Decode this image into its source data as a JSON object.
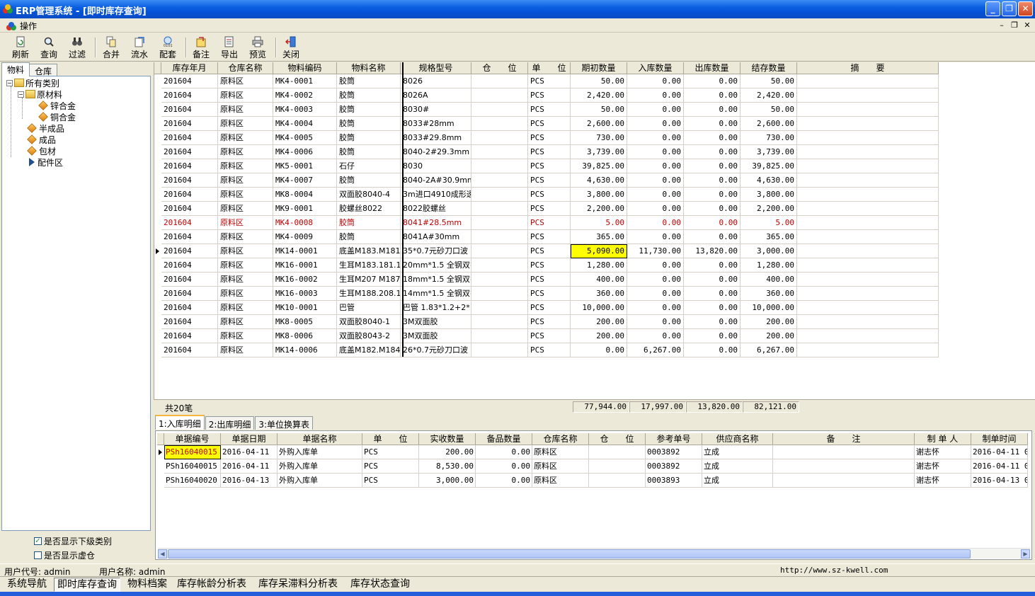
{
  "window": {
    "title": "ERP管理系统 - [即时库存查询]",
    "minimize": "_",
    "maximize": "❐",
    "close": "✕"
  },
  "menu": {
    "label": "操作"
  },
  "toolbar": {
    "refresh": "刷新",
    "query": "查询",
    "filter": "过滤",
    "merge": "合并",
    "flow": "流水",
    "match": "配套",
    "note": "备注",
    "export": "导出",
    "preview": "预览",
    "close": "关闭"
  },
  "left": {
    "tab_material": "物料",
    "tab_warehouse": "仓库",
    "tree": {
      "root": "所有类别",
      "raw": "原材料",
      "zinc": "锌合金",
      "copper": "铜合金",
      "semi": "半成品",
      "finished": "成品",
      "pack": "包材",
      "parts": "配件区"
    },
    "chk_sub": "是否显示下级类别",
    "chk_virtual": "是否显示虚仓"
  },
  "grid": {
    "headers": [
      "库存年月",
      "仓库名称",
      "物料编码",
      "物料名称",
      "规格型号",
      "仓　　位",
      "单　　位",
      "期初数量",
      "入库数量",
      "出库数量",
      "结存数量",
      "摘　　要"
    ],
    "rows": [
      [
        "201604",
        "原料区",
        "MK4-0001",
        "胶筒",
        "8026",
        "",
        "PCS",
        "50.00",
        "0.00",
        "0.00",
        "50.00",
        ""
      ],
      [
        "201604",
        "原料区",
        "MK4-0002",
        "胶筒",
        "8026A",
        "",
        "PCS",
        "2,420.00",
        "0.00",
        "0.00",
        "2,420.00",
        ""
      ],
      [
        "201604",
        "原料区",
        "MK4-0003",
        "胶筒",
        "8030#",
        "",
        "PCS",
        "50.00",
        "0.00",
        "0.00",
        "50.00",
        ""
      ],
      [
        "201604",
        "原料区",
        "MK4-0004",
        "胶筒",
        "8033#28mm",
        "",
        "PCS",
        "2,600.00",
        "0.00",
        "0.00",
        "2,600.00",
        ""
      ],
      [
        "201604",
        "原料区",
        "MK4-0005",
        "胶筒",
        "8033#29.8mm",
        "",
        "PCS",
        "730.00",
        "0.00",
        "0.00",
        "730.00",
        ""
      ],
      [
        "201604",
        "原料区",
        "MK4-0006",
        "胶筒",
        "8040-2#29.3mm",
        "",
        "PCS",
        "3,739.00",
        "0.00",
        "0.00",
        "3,739.00",
        ""
      ],
      [
        "201604",
        "原料区",
        "MK5-0001",
        "石仔",
        "8030",
        "",
        "PCS",
        "39,825.00",
        "0.00",
        "0.00",
        "39,825.00",
        ""
      ],
      [
        "201604",
        "原料区",
        "MK4-0007",
        "胶筒",
        "8040-2A#30.9mm",
        "",
        "PCS",
        "4,630.00",
        "0.00",
        "0.00",
        "4,630.00",
        ""
      ],
      [
        "201604",
        "原料区",
        "MK8-0004",
        "双面胶8040-4",
        "3m进口4910成形透",
        "",
        "PCS",
        "3,800.00",
        "0.00",
        "0.00",
        "3,800.00",
        ""
      ],
      [
        "201604",
        "原料区",
        "MK9-0001",
        "胶螺丝8022",
        "8022胶螺丝",
        "",
        "PCS",
        "2,200.00",
        "0.00",
        "0.00",
        "2,200.00",
        ""
      ],
      [
        "201604",
        "原料区",
        "MK4-0008",
        "胶筒",
        "8041#28.5mm",
        "",
        "PCS",
        "5.00",
        "0.00",
        "0.00",
        "5.00",
        ""
      ],
      [
        "201604",
        "原料区",
        "MK4-0009",
        "胶筒",
        "8041A#30mm",
        "",
        "PCS",
        "365.00",
        "0.00",
        "0.00",
        "365.00",
        ""
      ],
      [
        "201604",
        "原料区",
        "MK14-0001",
        "底盖M183.M181",
        "35*0.7元砂刀口波",
        "",
        "PCS",
        "5,090.00",
        "11,730.00",
        "13,820.00",
        "3,000.00",
        ""
      ],
      [
        "201604",
        "原料区",
        "MK16-0001",
        "生耳M183.181.19",
        "20mm*1.5 全钢双扌",
        "",
        "PCS",
        "1,280.00",
        "0.00",
        "0.00",
        "1,280.00",
        ""
      ],
      [
        "201604",
        "原料区",
        "MK16-0002",
        "生耳M207 M187",
        "18mm*1.5 全钢双扌",
        "",
        "PCS",
        "400.00",
        "0.00",
        "0.00",
        "400.00",
        ""
      ],
      [
        "201604",
        "原料区",
        "MK16-0003",
        "生耳M188.208.18",
        "14mm*1.5 全钢双扌",
        "",
        "PCS",
        "360.00",
        "0.00",
        "0.00",
        "360.00",
        ""
      ],
      [
        "201604",
        "原料区",
        "MK10-0001",
        "巴管",
        "巴管 1.83*1.2+2*",
        "",
        "PCS",
        "10,000.00",
        "0.00",
        "0.00",
        "10,000.00",
        ""
      ],
      [
        "201604",
        "原料区",
        "MK8-0005",
        "双面胶8040-1",
        "3M双面胶",
        "",
        "PCS",
        "200.00",
        "0.00",
        "0.00",
        "200.00",
        ""
      ],
      [
        "201604",
        "原料区",
        "MK8-0006",
        "双面胶8043-2",
        "3M双面胶",
        "",
        "PCS",
        "200.00",
        "0.00",
        "0.00",
        "200.00",
        ""
      ],
      [
        "201604",
        "原料区",
        "MK14-0006",
        "底盖M182.M184",
        "26*0.7元砂刀口波",
        "",
        "PCS",
        "0.00",
        "6,267.00",
        "0.00",
        "6,267.00",
        ""
      ]
    ],
    "footer": {
      "count": "共20笔",
      "opening": "77,944.00",
      "in": "17,997.00",
      "out": "13,820.00",
      "balance": "82,121.00"
    }
  },
  "detail": {
    "tabs": [
      "1:入库明细",
      "2:出库明细",
      "3:单位换算表"
    ],
    "headers": [
      "单据编号",
      "单据日期",
      "单据名称",
      "单　　位",
      "实收数量",
      "备品数量",
      "仓库名称",
      "仓　　位",
      "参考单号",
      "供应商名称",
      "备　　注",
      "制 单 人",
      "制单时间"
    ],
    "rows": [
      [
        "PSh16040015",
        "2016-04-11",
        "外购入库单",
        "PCS",
        "200.00",
        "0.00",
        "原料区",
        "",
        "0003892",
        "立成",
        "",
        "谢志怀",
        "2016-04-11 08:"
      ],
      [
        "PSh16040015",
        "2016-04-11",
        "外购入库单",
        "PCS",
        "8,530.00",
        "0.00",
        "原料区",
        "",
        "0003892",
        "立成",
        "",
        "谢志怀",
        "2016-04-11 08:"
      ],
      [
        "PSh16040020",
        "2016-04-13",
        "外购入库单",
        "PCS",
        "3,000.00",
        "0.00",
        "原料区",
        "",
        "0003893",
        "立成",
        "",
        "谢志怀",
        "2016-04-13 09:"
      ]
    ]
  },
  "status": {
    "user_code": "用户代号: admin",
    "user_name": "用户名称: admin",
    "url": "http://www.sz-kwell.com"
  },
  "taskbar": [
    "系统导航",
    "即时库存查询",
    "物料档案",
    "库存帐龄分析表",
    "库存呆滞料分析表",
    "库存状态查询"
  ]
}
